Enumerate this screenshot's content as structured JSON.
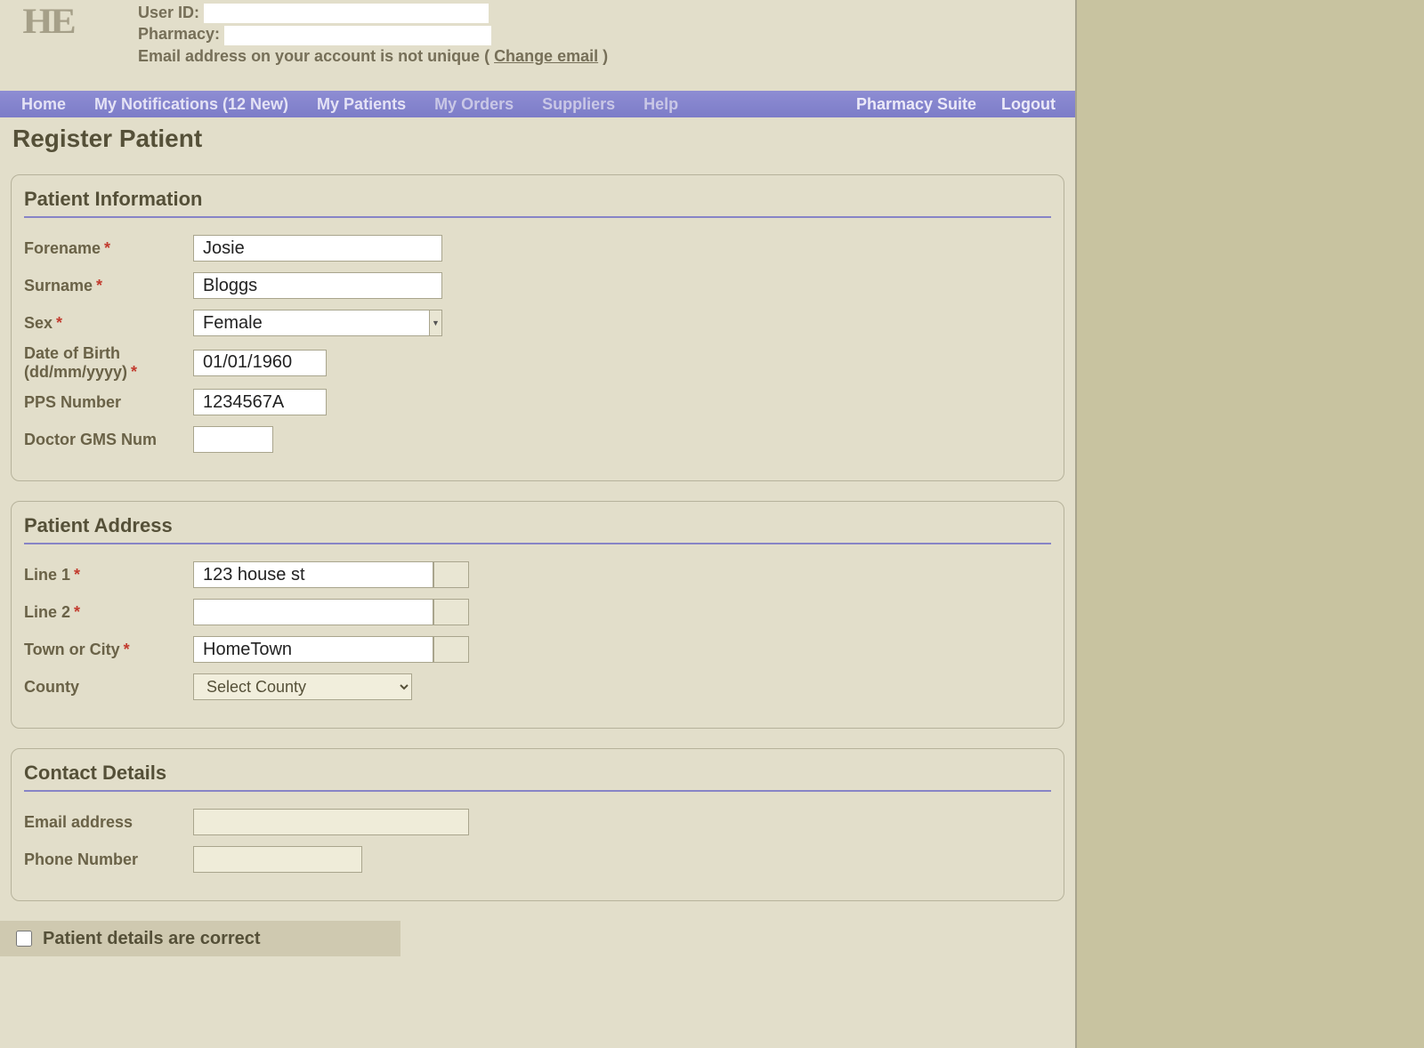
{
  "header": {
    "logo_text": "HE",
    "user_id_label": "User ID:",
    "pharmacy_label": "Pharmacy:",
    "email_warning_prefix": "Email address on your account is not unique ( ",
    "email_warning_link": "Change email",
    "email_warning_suffix": " )"
  },
  "nav": {
    "home": "Home",
    "notifications": "My Notifications (12 New)",
    "patients": "My Patients",
    "orders": "My Orders",
    "suppliers": "Suppliers",
    "help": "Help",
    "suite": "Pharmacy Suite",
    "logout": "Logout"
  },
  "page_title": "Register Patient",
  "section_patient_info": {
    "legend": "Patient Information",
    "forename_label": "Forename",
    "forename_value": "Josie",
    "surname_label": "Surname",
    "surname_value": "Bloggs",
    "sex_label": "Sex",
    "sex_value": "Female",
    "dob_label_line1": "Date of Birth",
    "dob_label_line2": "(dd/mm/yyyy)",
    "dob_value": "01/01/1960",
    "pps_label": "PPS Number",
    "pps_value": "1234567A",
    "gms_label": "Doctor GMS Num",
    "gms_value": ""
  },
  "section_address": {
    "legend": "Patient Address",
    "line1_label": "Line 1",
    "line1_value": "123 house st",
    "line2_label": "Line 2",
    "line2_value": "",
    "town_label": "Town or City",
    "town_value": "HomeTown",
    "county_label": "County",
    "county_value": "Select County"
  },
  "section_contact": {
    "legend": "Contact Details",
    "email_label": "Email address",
    "email_value": "",
    "phone_label": "Phone Number",
    "phone_value": ""
  },
  "confirm": {
    "label": "Patient details are correct"
  }
}
